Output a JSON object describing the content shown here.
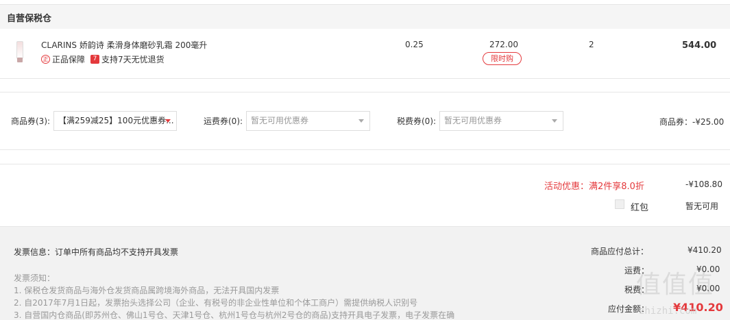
{
  "section": {
    "title": "自营保税仓"
  },
  "product": {
    "name": "CLARINS 娇韵诗 柔滑身体磨砂乳霜 200毫升",
    "badge_genuine_icon": "正",
    "badge_genuine": "正品保障",
    "badge_return_icon": "7",
    "badge_return": "支持7天无忧退货",
    "tax_rate": "0.25",
    "unit_price": "272.00",
    "limit_tag": "限时购",
    "quantity": "2",
    "subtotal": "544.00"
  },
  "coupons": {
    "goods_label": "商品券(3):",
    "goods_selected": "【满259减25】100元优惠券...",
    "shipping_label": "运费券(0):",
    "shipping_selected": "暂无可用优惠券",
    "tax_label": "税费券(0):",
    "tax_selected": "暂无可用优惠券",
    "discount_summary": "商品券：-¥25.00"
  },
  "promotion": {
    "text": "活动优惠：满2件享8.0折",
    "value": "-¥108.80",
    "hongbao_label": "红包",
    "hongbao_value": "暂无可用"
  },
  "invoice": {
    "info": "发票信息：订单中所有商品均不支持开具发票",
    "notes_title": "发票须知：",
    "notes": [
      "1. 保税仓发货商品与海外仓发货商品属跨境海外商品，无法开具国内发票",
      "2. 自2017年7月1日起，发票抬头选择公司（企业、有税号的非企业性单位和个体工商户）需提供纳税人识别号",
      "3. 自营国内仓商品(即苏州仓、佛山1号仓、天津1号仓、杭州1号仓与杭州2号仓的商品)支持开具电子发票，电子发票在确"
    ]
  },
  "summary": {
    "goods_total_label": "商品应付总计：",
    "goods_total_value": "¥410.20",
    "shipping_label": "运费：",
    "shipping_value": "¥0.00",
    "tax_label": "税费：",
    "tax_value": "¥0.00",
    "payable_label": "应付金额：",
    "payable_value": "¥410.20"
  },
  "watermark": {
    "main": "值值值",
    "sub": "zhizhi.com"
  },
  "colors": {
    "accent": "#e4393c",
    "muted": "#999999",
    "footer_bg": "#f2f2f2"
  }
}
